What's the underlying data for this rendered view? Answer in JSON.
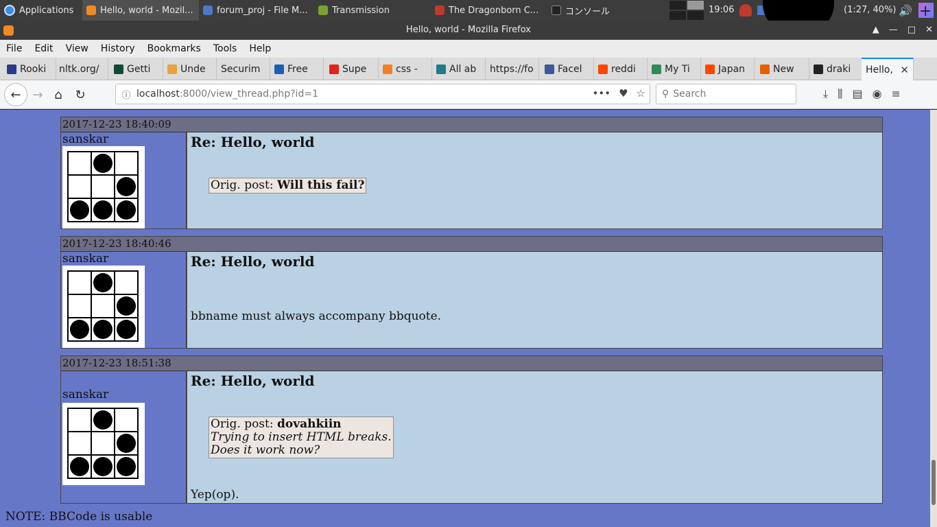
{
  "taskbar": {
    "applications_label": "Applications",
    "tasks": [
      {
        "label": "Hello, world - Mozil...",
        "icon": "firefox-icon",
        "color": "#f28a24"
      },
      {
        "label": "forum_proj - File M...",
        "icon": "folder-icon",
        "color": "#4e78c4"
      },
      {
        "label": "Transmission",
        "icon": "transmission-icon",
        "color": "#7ca32f"
      },
      {
        "label": "The Dragonborn C...",
        "icon": "santa-icon",
        "color": "#c0392b"
      },
      {
        "label": "コンソール",
        "icon": "terminal-icon",
        "color": "#222222"
      }
    ],
    "clock": "19:06",
    "battery": "(1:27, 40%)"
  },
  "window": {
    "title": "Hello, world - Mozilla Firefox"
  },
  "menu": [
    "File",
    "Edit",
    "View",
    "History",
    "Bookmarks",
    "Tools",
    "Help"
  ],
  "tabs": [
    {
      "label": "Rooki",
      "icon": "building-icon",
      "color": "#2b3a8a"
    },
    {
      "label": "nltk.org/",
      "icon": "",
      "color": ""
    },
    {
      "label": "Getti",
      "icon": "django-icon",
      "color": "#0c4b33"
    },
    {
      "label": "Unde",
      "icon": "chevron-icon",
      "color": "#e8a33a"
    },
    {
      "label": "Securim",
      "icon": "",
      "color": ""
    },
    {
      "label": "Free",
      "icon": "freecodecamp-icon",
      "color": "#1b5fb5"
    },
    {
      "label": "Supe",
      "icon": "youtube-icon",
      "color": "#e62117"
    },
    {
      "label": "css -",
      "icon": "stackoverflow-icon",
      "color": "#f48024"
    },
    {
      "label": "All ab",
      "icon": "archive-icon",
      "color": "#1f7a8c"
    },
    {
      "label": "https://fo",
      "icon": "",
      "color": ""
    },
    {
      "label": "Facel",
      "icon": "facebook-icon",
      "color": "#3b5998"
    },
    {
      "label": "reddi",
      "icon": "reddit-icon",
      "color": "#ff4500"
    },
    {
      "label": "My Ti",
      "icon": "map-icon",
      "color": "#2e8b57"
    },
    {
      "label": "Japan",
      "icon": "reddit-icon",
      "color": "#ff4500"
    },
    {
      "label": "New",
      "icon": "firefox-icon",
      "color": "#e66000"
    },
    {
      "label": "draki",
      "icon": "github-icon",
      "color": "#222222"
    },
    {
      "label": "Hello,",
      "icon": "",
      "color": ""
    }
  ],
  "nav": {
    "url_host": "localhost",
    "url_rest": ":8000/view_thread.php?id=1",
    "search_placeholder": "Search"
  },
  "posts": [
    {
      "timestamp": "2017-12-23 18:40:09",
      "user": "sanskar",
      "title": "Re: Hello, world",
      "quote": {
        "prefix": "Orig. post: ",
        "author": "Will this fail?",
        "lines": []
      },
      "text": ""
    },
    {
      "timestamp": "2017-12-23 18:40:46",
      "user": "sanskar",
      "title": "Re: Hello, world",
      "quote": null,
      "text": "bbname must always accompany bbquote."
    },
    {
      "timestamp": "2017-12-23 18:51:38",
      "user": "sanskar",
      "title": "Re: Hello, world",
      "quote": {
        "prefix": "Orig. post: ",
        "author": "dovahkiin",
        "lines": [
          "Trying to insert HTML breaks.",
          "Does it work now?"
        ]
      },
      "text": "Yep(op)."
    }
  ],
  "note": "NOTE: BBCode is usable"
}
